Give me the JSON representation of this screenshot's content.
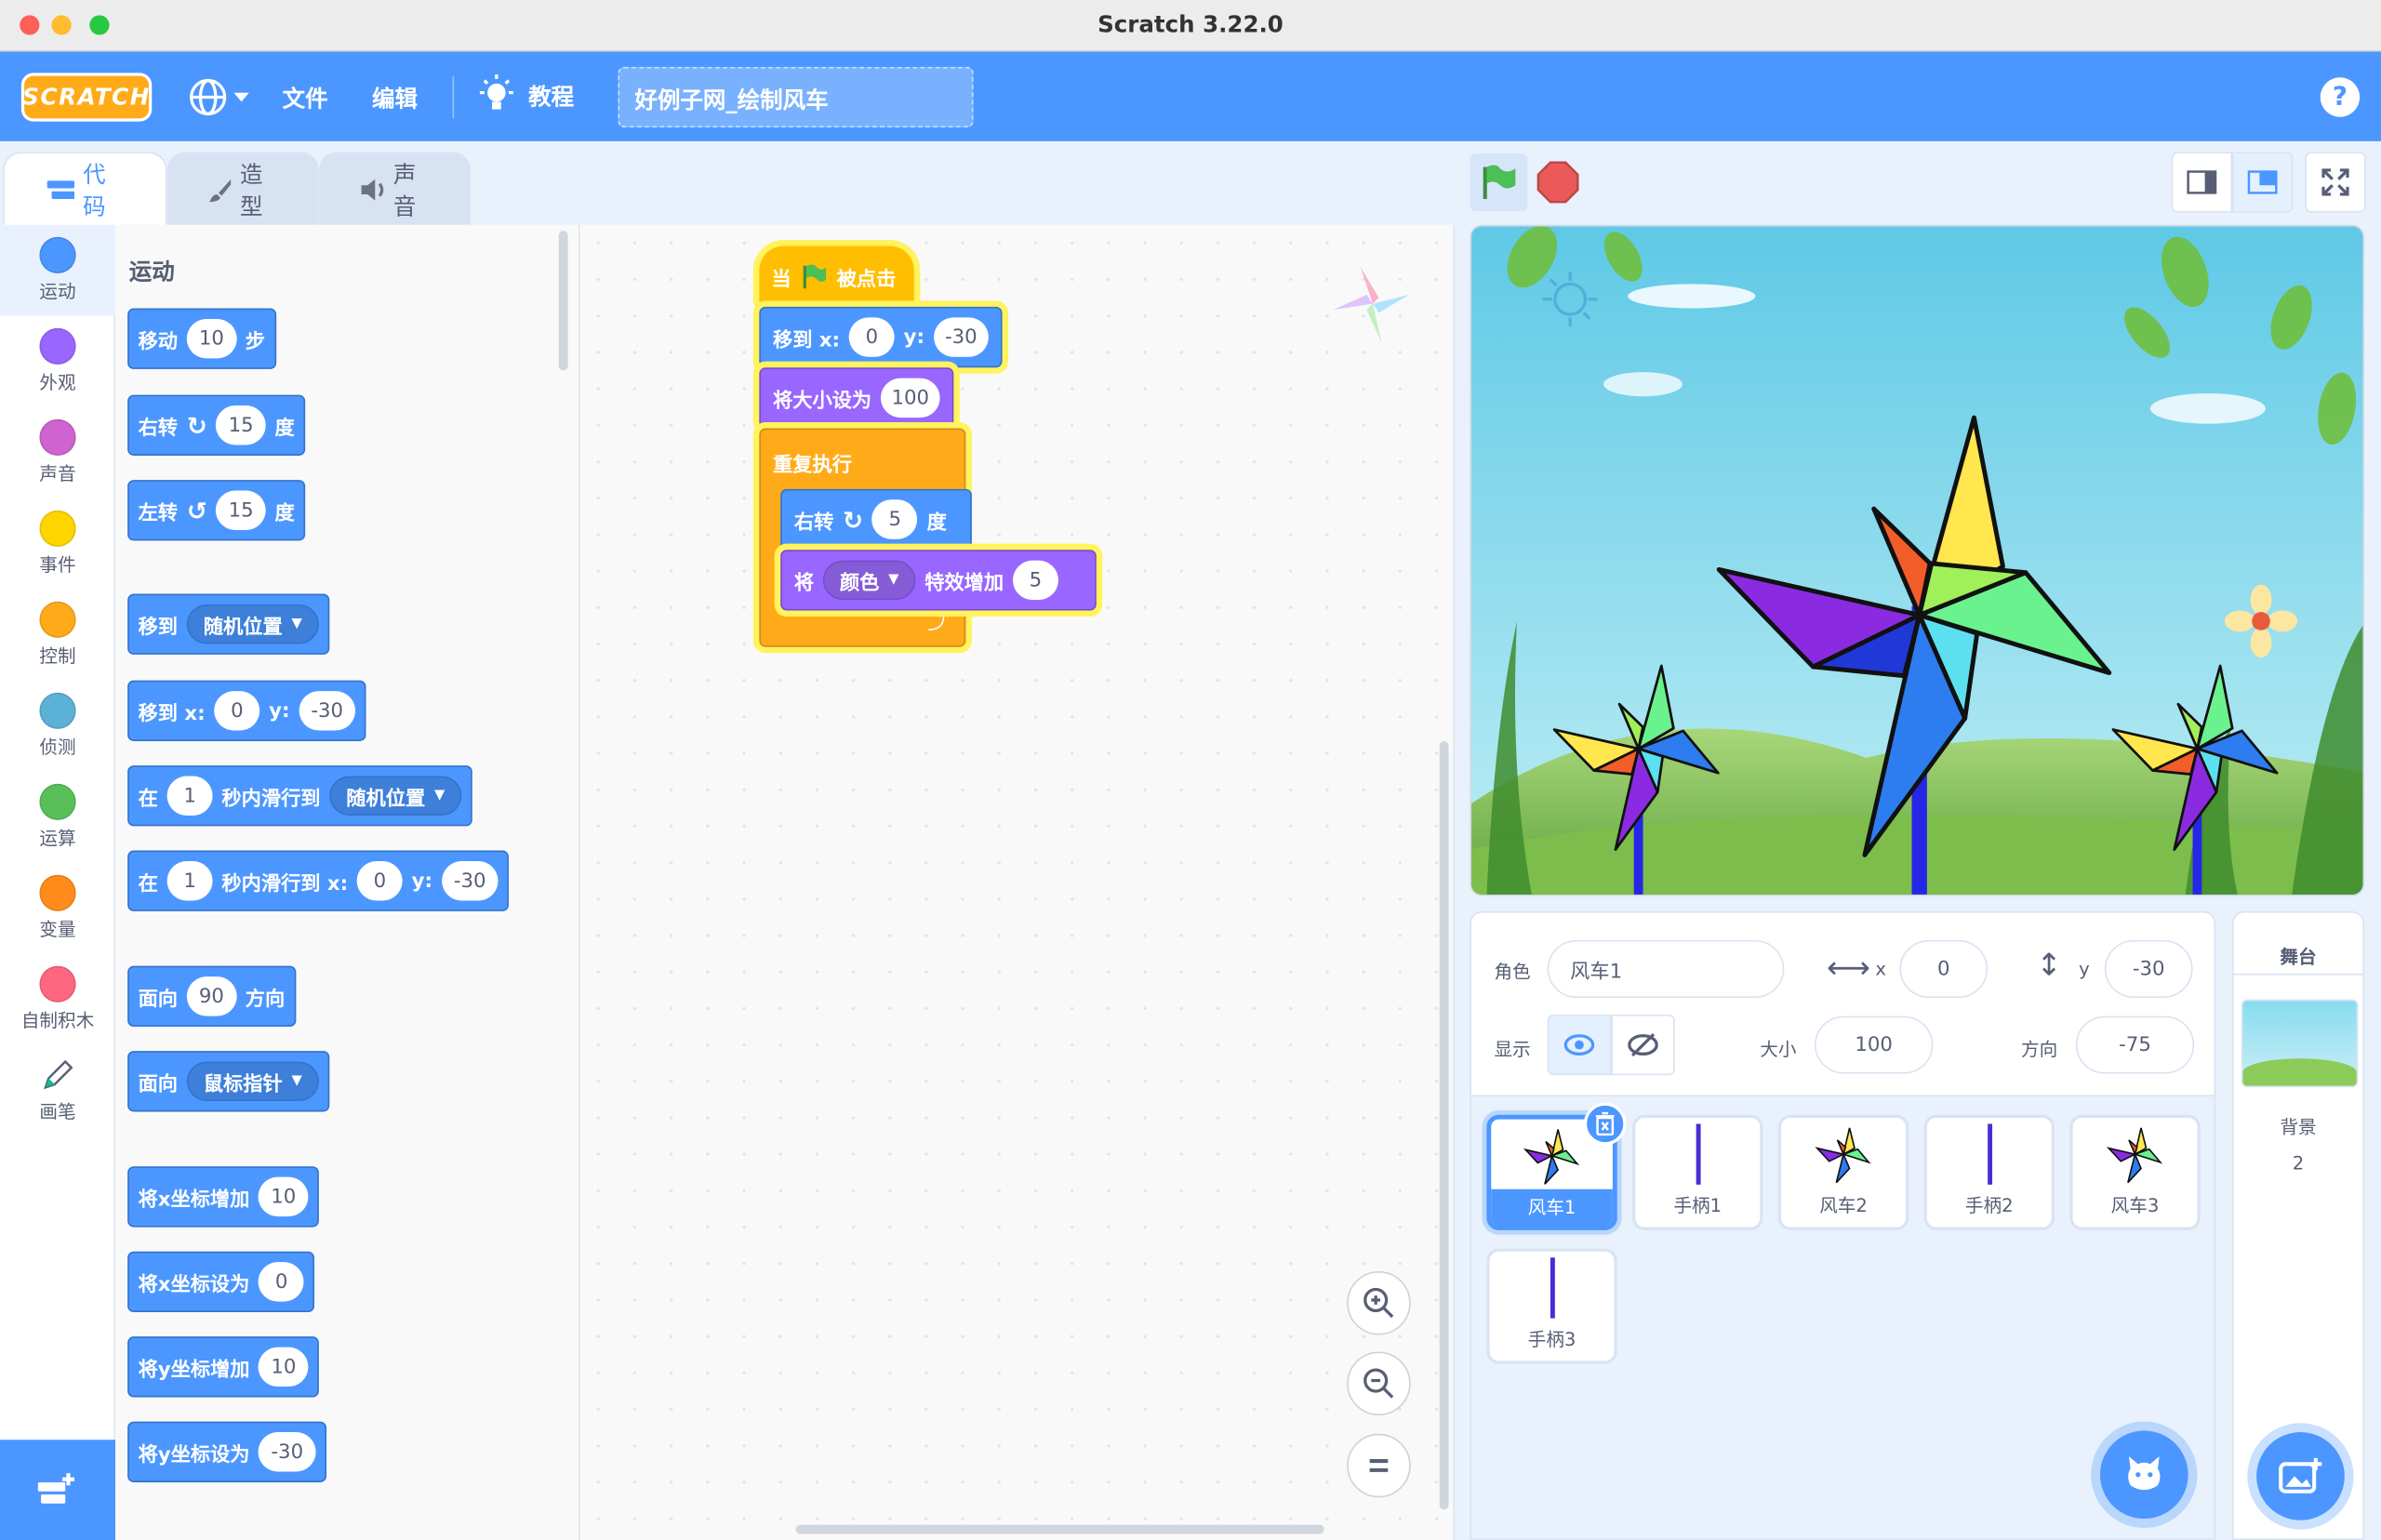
{
  "window": {
    "title": "Scratch 3.22.0"
  },
  "menubar": {
    "logo": "SCRATCH",
    "file": "文件",
    "edit": "编辑",
    "tutorials": "教程",
    "project_title": "好例子网_绘制风车",
    "help": "?"
  },
  "tabs": {
    "code": "代码",
    "costumes": "造型",
    "sounds": "声音"
  },
  "categories": [
    {
      "label": "运动",
      "color": "#4c97ff"
    },
    {
      "label": "外观",
      "color": "#9966ff"
    },
    {
      "label": "声音",
      "color": "#cf63cf"
    },
    {
      "label": "事件",
      "color": "#ffd500"
    },
    {
      "label": "控制",
      "color": "#ffab19"
    },
    {
      "label": "侦测",
      "color": "#5cb1d6"
    },
    {
      "label": "运算",
      "color": "#59c059"
    },
    {
      "label": "变量",
      "color": "#ff8c1a"
    },
    {
      "label": "自制积木",
      "color": "#ff6680"
    },
    {
      "label": "画笔",
      "color": "#0fbd8c"
    }
  ],
  "palette": {
    "heading": "运动",
    "move": {
      "a": "移动",
      "v": "10",
      "b": "步"
    },
    "turn_right": {
      "a": "右转",
      "v": "15",
      "b": "度"
    },
    "turn_left": {
      "a": "左转",
      "v": "15",
      "b": "度"
    },
    "goto": {
      "a": "移到",
      "dd": "随机位置"
    },
    "goto_xy": {
      "a": "移到 x:",
      "x": "0",
      "y_label": "y:",
      "y": "-30"
    },
    "glide": {
      "a": "在",
      "v": "1",
      "b": "秒内滑行到",
      "dd": "随机位置"
    },
    "glide_xy": {
      "a": "在",
      "v": "1",
      "b": "秒内滑行到 x:",
      "x": "0",
      "y_label": "y:",
      "y": "-30"
    },
    "point_dir": {
      "a": "面向",
      "v": "90",
      "b": "方向"
    },
    "point_towards": {
      "a": "面向",
      "dd": "鼠标指针"
    },
    "change_x": {
      "a": "将x坐标增加",
      "v": "10"
    },
    "set_x": {
      "a": "将x坐标设为",
      "v": "0"
    },
    "change_y": {
      "a": "将y坐标增加",
      "v": "10"
    },
    "set_y": {
      "a": "将y坐标设为",
      "v": "-30"
    }
  },
  "script": {
    "hat": {
      "a": "当",
      "b": "被点击"
    },
    "goto": {
      "a": "移到 x:",
      "x": "0",
      "y_label": "y:",
      "y": "-30"
    },
    "size": {
      "a": "将大小设为",
      "v": "100"
    },
    "forever": "重复执行",
    "turn": {
      "a": "右转",
      "v": "5",
      "b": "度"
    },
    "effect": {
      "a": "将",
      "dd": "颜色",
      "b": "特效增加",
      "v": "5"
    }
  },
  "sprite_info": {
    "sprite_label": "角色",
    "sprite_name": "风车1",
    "x_label": "x",
    "x": "0",
    "y_label": "y",
    "y": "-30",
    "show_label": "显示",
    "size_label": "大小",
    "size": "100",
    "direction_label": "方向",
    "direction": "-75"
  },
  "sprites": [
    {
      "name": "风车1",
      "kind": "pinwheel"
    },
    {
      "name": "手柄1",
      "kind": "handle"
    },
    {
      "name": "风车2",
      "kind": "pinwheel"
    },
    {
      "name": "手柄2",
      "kind": "handle"
    },
    {
      "name": "风车3",
      "kind": "pinwheel"
    },
    {
      "name": "手柄3",
      "kind": "handle"
    }
  ],
  "stage_panel": {
    "title": "舞台",
    "backdrop_label": "背景",
    "backdrop_count": "2"
  }
}
